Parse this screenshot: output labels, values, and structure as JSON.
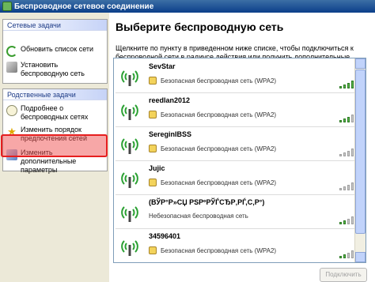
{
  "window": {
    "title": "Беспроводное сетевое соединение"
  },
  "left_groups": {
    "network_tasks": {
      "title": "Сетевые задачи",
      "items": [
        {
          "label": "Обновить список сети",
          "icon": "refresh-icon"
        },
        {
          "label": "Установить беспроводную сеть",
          "icon": "wireless-setup-icon"
        }
      ]
    },
    "related_tasks": {
      "title": "Родственные задачи",
      "items": [
        {
          "label": "Подробнее о беспроводных сетях",
          "icon": "info-icon"
        },
        {
          "label": "Изменить порядок предпочтения сетей",
          "icon": "star-icon",
          "highlighted": true
        },
        {
          "label": "Изменить дополнительные параметры",
          "icon": "advanced-settings-icon"
        }
      ]
    }
  },
  "main": {
    "heading": "Выберите беспроводную сеть",
    "instructions": "Щелкните по пункту в приведенном ниже списке, чтобы подключиться к беспроводной сети в радиусе действия или получить дополнительные сведения.",
    "networks": [
      {
        "name": "SevStar",
        "security": "Безопасная беспроводная сеть (WPA2)",
        "signal_bars": 5,
        "secured": true
      },
      {
        "name": "reedlan2012",
        "security": "Безопасная беспроводная сеть (WPA2)",
        "signal_bars": 3,
        "secured": true
      },
      {
        "name": "SereginIBSS",
        "security": "Безопасная беспроводная сеть (WPA2)",
        "signal_bars": 0,
        "secured": true
      },
      {
        "name": "Jujic",
        "security": "Безопасная беспроводная сеть (WPA2)",
        "signal_bars": 0,
        "secured": true
      },
      {
        "name": "(ВЎР°Р»СЏ РЅРºРЎЃСЂР‚РЃ,С‚Р°)",
        "security": "Небезопасная беспроводная сеть",
        "signal_bars": 2,
        "secured": false
      },
      {
        "name": "34596401",
        "security": "Безопасная беспроводная сеть (WPA2)",
        "signal_bars": 2,
        "secured": true
      }
    ],
    "connect_button": "Подключить"
  },
  "colors": {
    "title_bar": "#0b3f8a",
    "highlight": "#e61e1e",
    "signal_on": "#57b846"
  }
}
